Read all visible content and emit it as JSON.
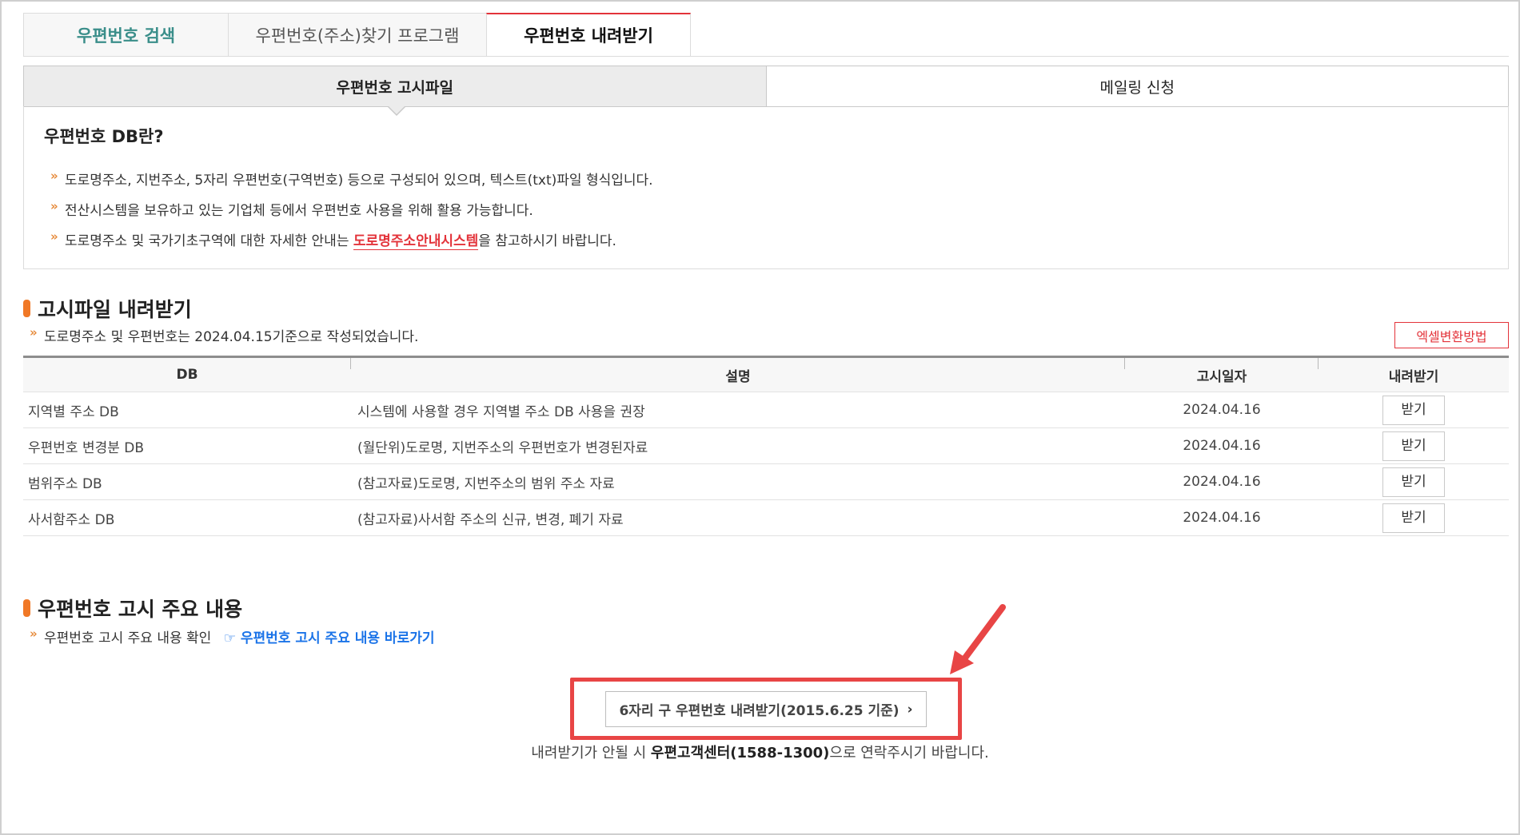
{
  "top_tabs": [
    "우편번호 검색",
    "우편번호(주소)찾기 프로그램",
    "우편번호 내려받기"
  ],
  "sub_tabs": [
    "우편번호 고시파일",
    "메일링 신청"
  ],
  "info": {
    "title": "우편번호 DB란?",
    "items": [
      "도로명주소, 지번주소, 5자리 우편번호(구역번호) 등으로 구성되어 있으며, 텍스트(txt)파일 형식입니다.",
      "전산시스템을 보유하고 있는 기업체 등에서 우편번호 사용을 위해 활용 가능합니다."
    ],
    "item3_prefix": "도로명주소 및 국가기초구역에 대한 자세한 안내는 ",
    "item3_link": "도로명주소안내시스템",
    "item3_suffix": "을 참고하시기 바랍니다."
  },
  "download_section": {
    "title": "고시파일 내려받기",
    "note": "도로명주소 및 우편번호는 2024.04.15기준으로 작성되었습니다.",
    "excel_button": "엑셀변환방법",
    "headers": [
      "DB",
      "설명",
      "고시일자",
      "내려받기"
    ],
    "rows": [
      {
        "db": "지역별 주소 DB",
        "desc": "시스템에 사용할 경우 지역별 주소 DB 사용을 권장",
        "date": "2024.04.16",
        "button": "받기"
      },
      {
        "db": "우편번호 변경분 DB",
        "desc": "(월단위)도로명, 지번주소의 우편번호가 변경된자료",
        "date": "2024.04.16",
        "button": "받기"
      },
      {
        "db": "범위주소 DB",
        "desc": "(참고자료)도로명, 지번주소의 범위 주소 자료",
        "date": "2024.04.16",
        "button": "받기"
      },
      {
        "db": "사서함주소 DB",
        "desc": "(참고자료)사서함 주소의 신규, 변경, 폐기 자료",
        "date": "2024.04.16",
        "button": "받기"
      }
    ]
  },
  "notice_section": {
    "title": "우편번호 고시 주요 내용",
    "note": "우편번호 고시 주요 내용 확인",
    "link": "☞ 우편번호 고시 주요 내용 바로가기"
  },
  "old_download": {
    "button": "6자리 구 우편번호 내려받기(2015.6.25 기준)",
    "contact_prefix": "내려받기가 안될 시 ",
    "contact_bold": "우편고객센터(1588-1300)",
    "contact_suffix": "으로 연락주시기 바랍니다."
  },
  "colors": {
    "accent_red": "#e3333a",
    "teal": "#3a8e8a",
    "link_blue": "#1a73e8",
    "bullet_orange": "#e68a3a",
    "annotation_red": "#e84545"
  }
}
